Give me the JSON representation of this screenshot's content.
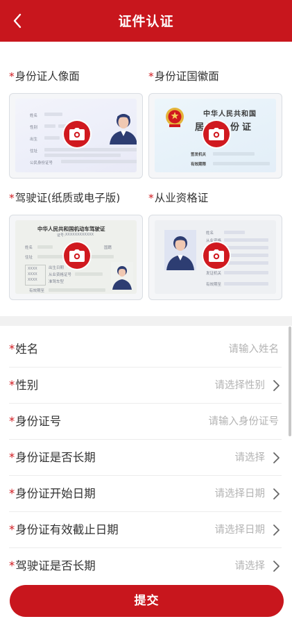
{
  "header": {
    "title": "证件认证"
  },
  "photos": {
    "id_front": {
      "label": "身份证人像面",
      "fields": [
        "姓名",
        "性别",
        "出生",
        "住址",
        "公民身份证号"
      ]
    },
    "id_back": {
      "label": "身份证国徽面",
      "country": "中华人民共和国",
      "doc_title": "居民身份证",
      "fields": [
        "签发机关",
        "有效期限"
      ]
    },
    "license": {
      "label": "驾驶证(纸质或电子版)",
      "title": "中华人民共和国机动车驾驶证",
      "number_label": "证号：",
      "number_value": "XXXXXXXXXXXX",
      "fields": [
        "姓名",
        "住址",
        "国籍",
        "出生日期",
        "从业资格证号",
        "准驾车型",
        "有效期至"
      ],
      "seal_text": [
        "XXXX",
        "XXXX",
        "XXXX"
      ]
    },
    "cert": {
      "label": "从业资格证",
      "fields": [
        "姓名",
        "从业资格",
        "证号",
        "发证机关",
        "有效期至"
      ]
    }
  },
  "form": {
    "required_mark": "*",
    "rows": [
      {
        "label": "姓名",
        "value": "请输入姓名",
        "arrow": false
      },
      {
        "label": "性别",
        "value": "请选择性别",
        "arrow": true
      },
      {
        "label": "身份证号",
        "value": "请输入身份证号",
        "arrow": false
      },
      {
        "label": "身份证是否长期",
        "value": "请选择",
        "arrow": true
      },
      {
        "label": "身份证开始日期",
        "value": "请选择日期",
        "arrow": true
      },
      {
        "label": "身份证有效截止日期",
        "value": "请选择日期",
        "arrow": true
      },
      {
        "label": "驾驶证是否长期",
        "value": "请选择",
        "arrow": true
      }
    ]
  },
  "submit": {
    "label": "提交"
  },
  "colors": {
    "primary": "#c8161d",
    "required": "#d0191f",
    "placeholder": "#b3b3b3"
  },
  "icons": {
    "back": "chevron-left-icon",
    "camera": "camera-icon",
    "arrow": "chevron-right-icon"
  }
}
